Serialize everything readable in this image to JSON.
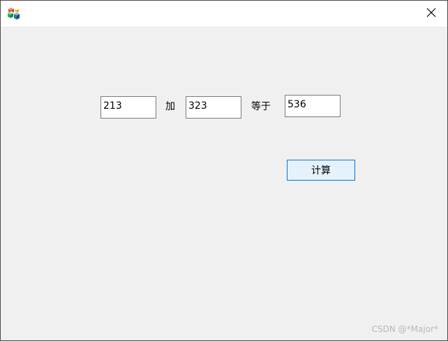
{
  "window": {
    "title": "",
    "close_icon": "close-icon",
    "app_icon": "app-cubes-icon"
  },
  "form": {
    "operand1_value": "213",
    "op_label": "加",
    "operand2_value": "323",
    "equals_label": "等于",
    "result_value": "536",
    "calc_button_label": "计算"
  },
  "watermark": "CSDN @*Major*",
  "colors": {
    "client_bg": "#f0f0f0",
    "button_border": "#0078d7",
    "button_bg": "#e5f1fb"
  }
}
